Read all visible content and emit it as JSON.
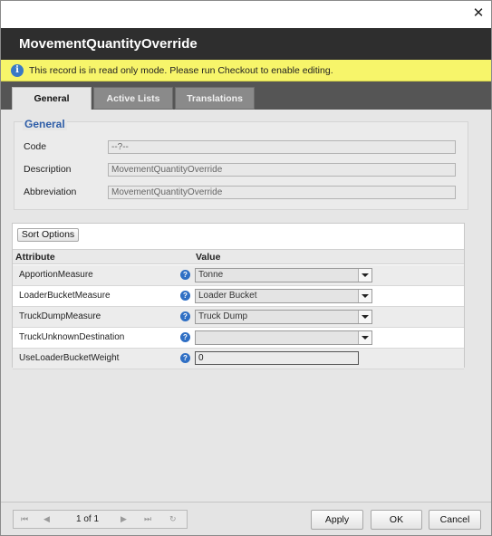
{
  "window": {
    "close_glyph": "✕",
    "title": "MovementQuantityOverride"
  },
  "notice": {
    "text": "This record is in read only mode. Please run Checkout to enable editing.",
    "icon": "info-icon"
  },
  "tabs": [
    {
      "label": "General",
      "active": true
    },
    {
      "label": "Active Lists",
      "active": false
    },
    {
      "label": "Translations",
      "active": false
    }
  ],
  "general": {
    "legend": "General",
    "fields": [
      {
        "label": "Code",
        "value": "--?--"
      },
      {
        "label": "Description",
        "value": "MovementQuantityOverride"
      },
      {
        "label": "Abbreviation",
        "value": "MovementQuantityOverride"
      }
    ]
  },
  "grid": {
    "sort_button": "Sort Options",
    "columns": {
      "attribute": "Attribute",
      "value": "Value"
    },
    "rows": [
      {
        "attribute": "ApportionMeasure",
        "value": "Tonne",
        "type": "combo"
      },
      {
        "attribute": "LoaderBucketMeasure",
        "value": "Loader Bucket",
        "type": "combo"
      },
      {
        "attribute": "TruckDumpMeasure",
        "value": "Truck Dump",
        "type": "combo"
      },
      {
        "attribute": "TruckUnknownDestination",
        "value": "",
        "type": "combo"
      },
      {
        "attribute": "UseLoaderBucketWeight",
        "value": "0",
        "type": "number"
      }
    ],
    "help_glyph": "?"
  },
  "pager": {
    "text": "1 of 1",
    "first": "⏮",
    "prev": "◀",
    "next": "▶",
    "last": "⏭",
    "refresh": "↻"
  },
  "buttons": {
    "apply": "Apply",
    "ok": "OK",
    "cancel": "Cancel"
  }
}
